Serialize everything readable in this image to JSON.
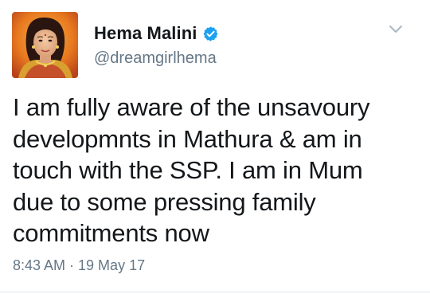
{
  "tweet": {
    "author": {
      "display_name": "Hema Malini",
      "handle": "@dreamgirlhema",
      "verified": true
    },
    "text": "I am fully aware of the unsavoury\ndevelopmnts in Mathura & am in\ntouch with the SSP. I am in Mum\ndue to some pressing family\ncommitments now",
    "timestamp": "8:43 AM · 19 May 17"
  },
  "icons": {
    "verified": "verified-badge-icon",
    "menu": "chevron-down-icon"
  },
  "colors": {
    "verified_blue": "#1da1f2",
    "secondary_text": "#657786",
    "primary_text": "#14171a",
    "avatar_background": "#e8791f"
  }
}
